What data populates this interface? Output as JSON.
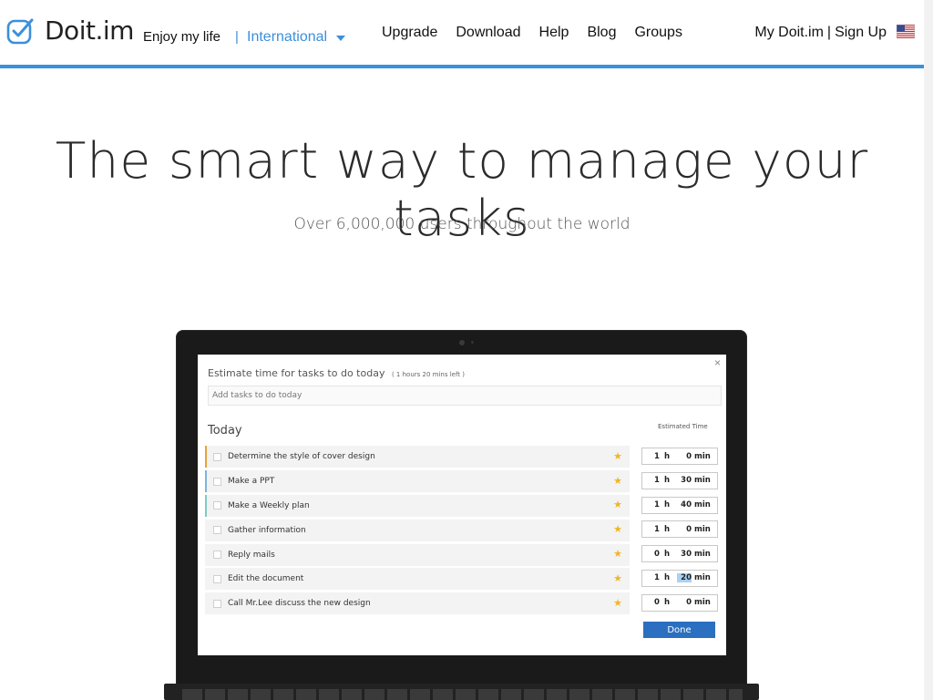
{
  "header": {
    "logo_text": "Doit.im",
    "tagline": "Enjoy my life",
    "separator": "|",
    "region": "International",
    "nav": [
      "Upgrade",
      "Download",
      "Help",
      "Blog",
      "Groups"
    ],
    "my_account": "My Doit.im",
    "account_separator": "|",
    "sign_up": "Sign Up",
    "accent_color": "#3b8fdc"
  },
  "hero": {
    "title": "The smart way to manage your tasks",
    "subtitle": "Over 6,000,000 users throughout the world"
  },
  "dialog": {
    "close": "×",
    "title": "Estimate time for tasks to do today",
    "time_left": "( 1 hours 20 mins left )",
    "add_placeholder": "Add tasks to do today",
    "section_label": "Today",
    "estimated_time_label": "Estimated Time",
    "hour_unit": "h",
    "minute_unit": "min",
    "done_label": "Done",
    "tasks": [
      {
        "title": "Determine the style of cover design",
        "hours": "1",
        "minutes": "0",
        "priority": "orange"
      },
      {
        "title": "Make a PPT",
        "hours": "1",
        "minutes": "30",
        "priority": "blue"
      },
      {
        "title": "Make a Weekly plan",
        "hours": "1",
        "minutes": "40",
        "priority": "teal"
      },
      {
        "title": "Gather information",
        "hours": "1",
        "minutes": "0",
        "priority": "none"
      },
      {
        "title": "Reply mails",
        "hours": "0",
        "minutes": "30",
        "priority": "none"
      },
      {
        "title": "Edit the document",
        "hours": "1",
        "minutes": "20",
        "priority": "none",
        "minutes_selected": true
      },
      {
        "title": "Call Mr.Lee discuss the new design",
        "hours": "0",
        "minutes": "0",
        "priority": "none"
      }
    ]
  }
}
